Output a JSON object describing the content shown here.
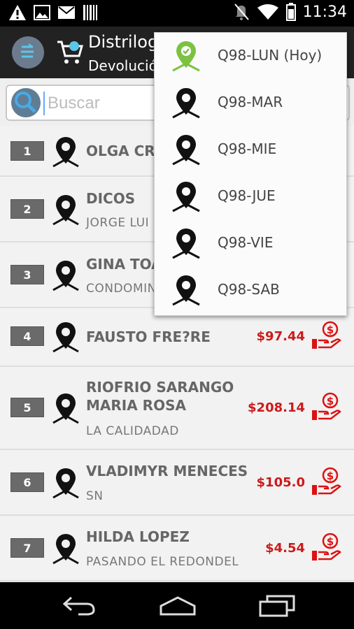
{
  "status_bar": {
    "time": "11:34",
    "left_icons": [
      "warning-icon",
      "image-icon",
      "mail-icon",
      "barcode-icon"
    ],
    "right_icons": [
      "mute-icon",
      "wifi-icon",
      "battery-icon"
    ]
  },
  "app_bar": {
    "title": "Distrilog",
    "subtitle": "Devolució"
  },
  "search": {
    "placeholder": "Buscar"
  },
  "customers": [
    {
      "number": "1",
      "name": "OLGA CR",
      "name2": "",
      "sub": "",
      "amount": ""
    },
    {
      "number": "2",
      "name": "DICOS",
      "name2": "",
      "sub": "JORGE LUI",
      "amount": ""
    },
    {
      "number": "3",
      "name": "GINA TOA",
      "name2": "",
      "sub": "CONDOMIN",
      "amount": ""
    },
    {
      "number": "4",
      "name": "FAUSTO FRE?RE",
      "name2": "",
      "sub": "",
      "amount": "$97.44"
    },
    {
      "number": "5",
      "name": "RIOFRIO SARANGO",
      "name2": "MARIA ROSA",
      "sub": "LA CALIDADAD",
      "amount": "$208.14"
    },
    {
      "number": "6",
      "name": "VLADIMYR MENECES",
      "name2": "",
      "sub": "SN",
      "amount": "$105.0"
    },
    {
      "number": "7",
      "name": "HILDA LOPEZ",
      "name2": "",
      "sub": "PASANDO EL REDONDEL",
      "amount": "$4.54"
    }
  ],
  "route_menu": [
    {
      "label": "Q98-LUN (Hoy)",
      "icon": "pin-check-icon",
      "color": "#7cc242"
    },
    {
      "label": "Q98-MAR",
      "icon": "pin-icon",
      "color": "#111111"
    },
    {
      "label": "Q98-MIE",
      "icon": "pin-icon",
      "color": "#111111"
    },
    {
      "label": "Q98-JUE",
      "icon": "pin-icon",
      "color": "#111111"
    },
    {
      "label": "Q98-VIE",
      "icon": "pin-icon",
      "color": "#111111"
    },
    {
      "label": "Q98-SAB",
      "icon": "pin-icon",
      "color": "#111111"
    }
  ],
  "colors": {
    "amount": "#cc1a1a",
    "today_pin": "#7cc242",
    "badge": "#6a6a6a",
    "action_bar": "#222222"
  },
  "nav_bar": {
    "buttons": [
      "back-icon",
      "home-icon",
      "recents-icon"
    ]
  }
}
